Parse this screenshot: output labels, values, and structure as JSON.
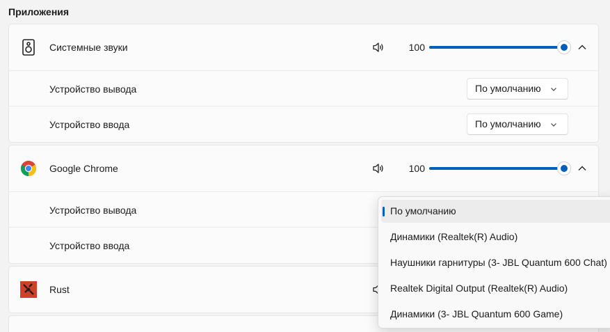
{
  "section": {
    "title": "Приложения"
  },
  "apps": [
    {
      "name": "Системные звуки",
      "icon": "speaker-device-icon",
      "volume": "100",
      "volume_level": 1.0,
      "output_label": "Устройство вывода",
      "output_value": "По умолчанию",
      "input_label": "Устройство ввода",
      "input_value": "По умолчанию"
    },
    {
      "name": "Google Chrome",
      "icon": "chrome-icon",
      "volume": "100",
      "volume_level": 1.0,
      "output_label": "Устройство вывода",
      "input_label": "Устройство ввода"
    },
    {
      "name": "Rust",
      "icon": "rust-icon"
    }
  ],
  "output_dropdown": {
    "options": [
      "По умолчанию",
      "Динамики (Realtek(R) Audio)",
      "Наушники гарнитуры (3- JBL Quantum 600 Chat)",
      "Realtek Digital Output (Realtek(R) Audio)",
      "Динамики (3- JBL Quantum 600 Game)"
    ],
    "selected_index": 0
  },
  "colors": {
    "accent": "#005fb8",
    "background": "#f3f3f3",
    "card": "#fbfbfb"
  }
}
